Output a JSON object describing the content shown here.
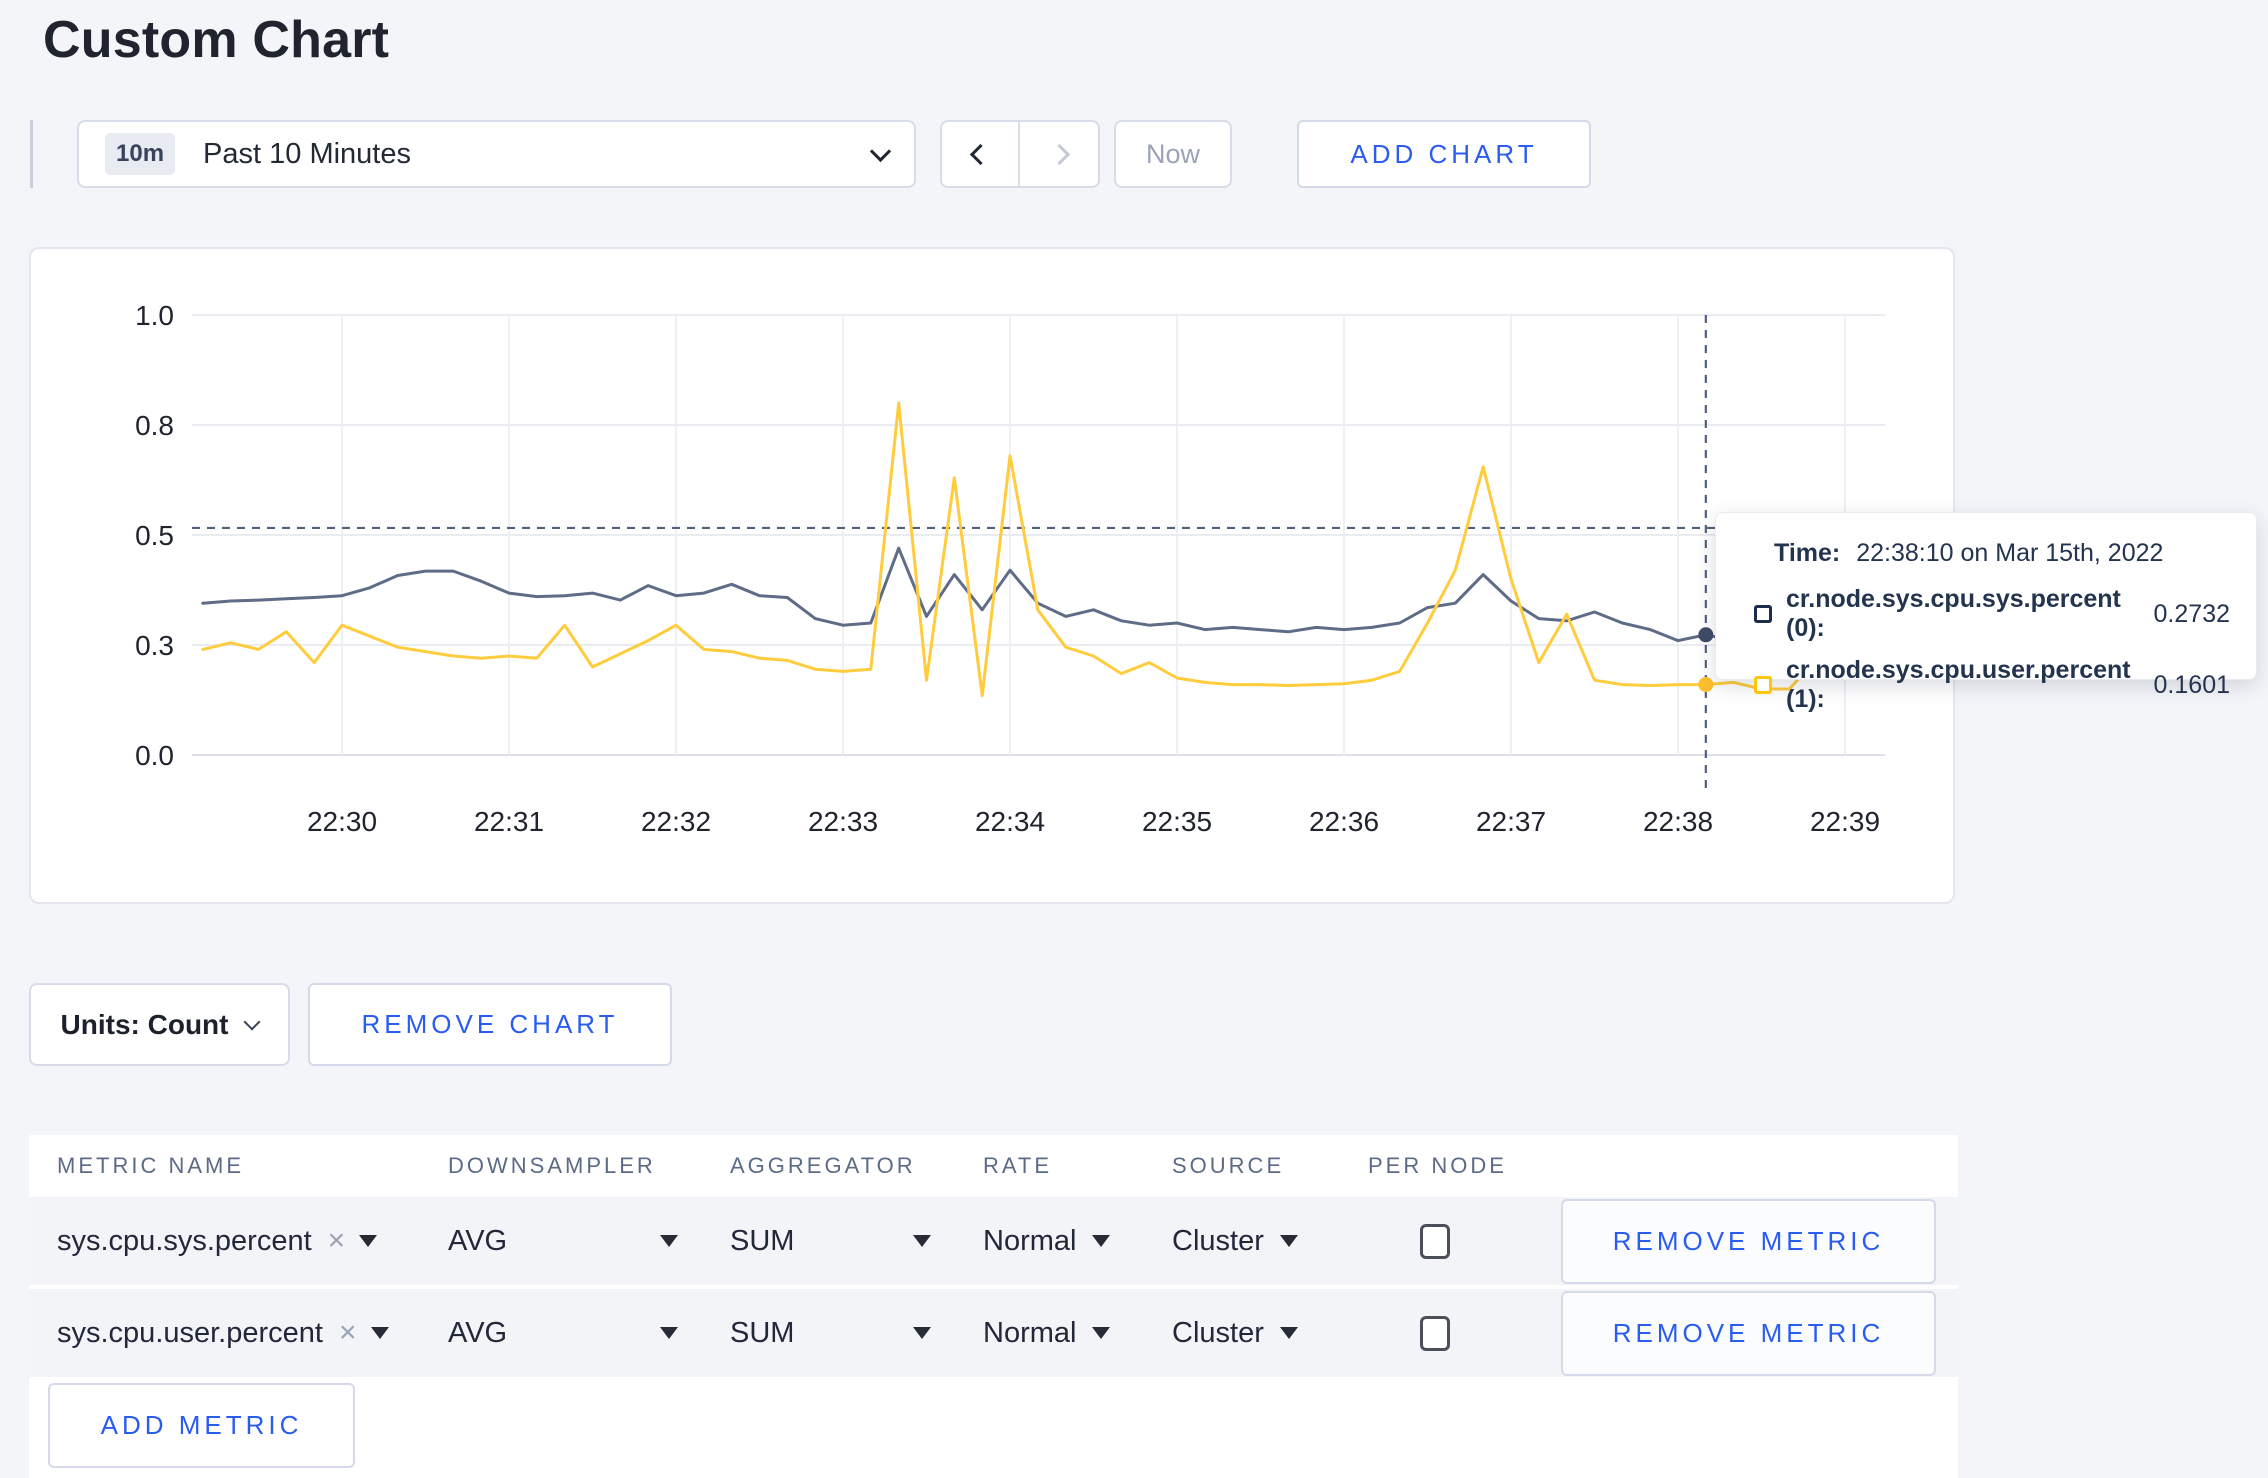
{
  "page": {
    "title": "Custom Chart",
    "background": "#f4f5f9",
    "accent_blue": "#2b5cf0"
  },
  "toolbar": {
    "range_badge": "10m",
    "range_label": "Past 10 Minutes",
    "now_label": "Now",
    "add_chart_label": "ADD CHART"
  },
  "tooltip": {
    "time_label": "Time:",
    "time_value": "22:38:10 on Mar 15th, 2022",
    "entries": [
      {
        "name": "cr.node.sys.cpu.sys.percent (0):",
        "value": "0.2732",
        "swatch_color": "#1d2c4c"
      },
      {
        "name": "cr.node.sys.cpu.user.percent (1):",
        "value": "0.1601",
        "swatch_color": "#ffc40c"
      }
    ]
  },
  "chart_data": {
    "type": "line",
    "title": "",
    "xlabel": "",
    "ylabel": "",
    "ylim": [
      0,
      1
    ],
    "grid": true,
    "x_start_time": "22:29:10",
    "x_interval_seconds": 10,
    "x_ticks": [
      "22:30",
      "22:31",
      "22:32",
      "22:33",
      "22:34",
      "22:35",
      "22:36",
      "22:37",
      "22:38",
      "22:39"
    ],
    "y_ticks": [
      {
        "value": 1.0,
        "label": "1.0"
      },
      {
        "value": 0.75,
        "label": "0.8"
      },
      {
        "value": 0.5,
        "label": "0.5"
      },
      {
        "value": 0.25,
        "label": "0.3"
      },
      {
        "value": 0.0,
        "label": "0.0"
      }
    ],
    "series": [
      {
        "name": "cr.node.sys.cpu.sys.percent (0)",
        "color": "#5f6c87",
        "values": [
          0.345,
          0.35,
          0.352,
          0.355,
          0.358,
          0.362,
          0.38,
          0.408,
          0.418,
          0.418,
          0.395,
          0.368,
          0.36,
          0.362,
          0.368,
          0.352,
          0.385,
          0.362,
          0.368,
          0.388,
          0.362,
          0.358,
          0.31,
          0.295,
          0.3,
          0.47,
          0.315,
          0.41,
          0.33,
          0.42,
          0.345,
          0.315,
          0.33,
          0.305,
          0.295,
          0.3,
          0.285,
          0.29,
          0.285,
          0.28,
          0.29,
          0.285,
          0.29,
          0.3,
          0.335,
          0.345,
          0.41,
          0.35,
          0.31,
          0.305,
          0.325,
          0.3,
          0.285,
          0.26,
          0.2732,
          0.26,
          0.3,
          0.31,
          0.295,
          0.3,
          0.305
        ]
      },
      {
        "name": "cr.node.sys.cpu.user.percent (1)",
        "color": "#ffcc3d",
        "values": [
          0.24,
          0.255,
          0.24,
          0.28,
          0.21,
          0.295,
          0.27,
          0.245,
          0.235,
          0.225,
          0.22,
          0.225,
          0.22,
          0.295,
          0.2,
          0.23,
          0.26,
          0.295,
          0.24,
          0.235,
          0.22,
          0.215,
          0.195,
          0.19,
          0.195,
          0.8,
          0.17,
          0.63,
          0.135,
          0.68,
          0.33,
          0.245,
          0.225,
          0.185,
          0.21,
          0.175,
          0.165,
          0.16,
          0.16,
          0.158,
          0.16,
          0.162,
          0.17,
          0.19,
          0.3,
          0.42,
          0.655,
          0.4,
          0.21,
          0.32,
          0.17,
          0.16,
          0.158,
          0.16,
          0.1601,
          0.165,
          0.15,
          0.15,
          0.22,
          0.245,
          0.19
        ]
      }
    ],
    "crosshair": {
      "time": "22:38:10",
      "point_index": 54,
      "hline_value": 0.516,
      "dot_colors": [
        "#3f4d68",
        "#fdbf2d"
      ]
    },
    "legend_position": "tooltip"
  },
  "units_row": {
    "units_label": "Units: Count",
    "remove_chart_label": "REMOVE CHART"
  },
  "metrics_table": {
    "headers": [
      "METRIC NAME",
      "DOWNSAMPLER",
      "AGGREGATOR",
      "RATE",
      "SOURCE",
      "PER NODE"
    ],
    "rows": [
      {
        "metric": "sys.cpu.sys.percent",
        "remove_x": "×",
        "downsampler": "AVG",
        "aggregator": "SUM",
        "rate": "Normal",
        "source": "Cluster",
        "per_node_checked": false,
        "remove_label": "REMOVE METRIC"
      },
      {
        "metric": "sys.cpu.user.percent",
        "remove_x": "×",
        "downsampler": "AVG",
        "aggregator": "SUM",
        "rate": "Normal",
        "source": "Cluster",
        "per_node_checked": false,
        "remove_label": "REMOVE METRIC"
      }
    ],
    "add_metric_label": "ADD METRIC"
  }
}
